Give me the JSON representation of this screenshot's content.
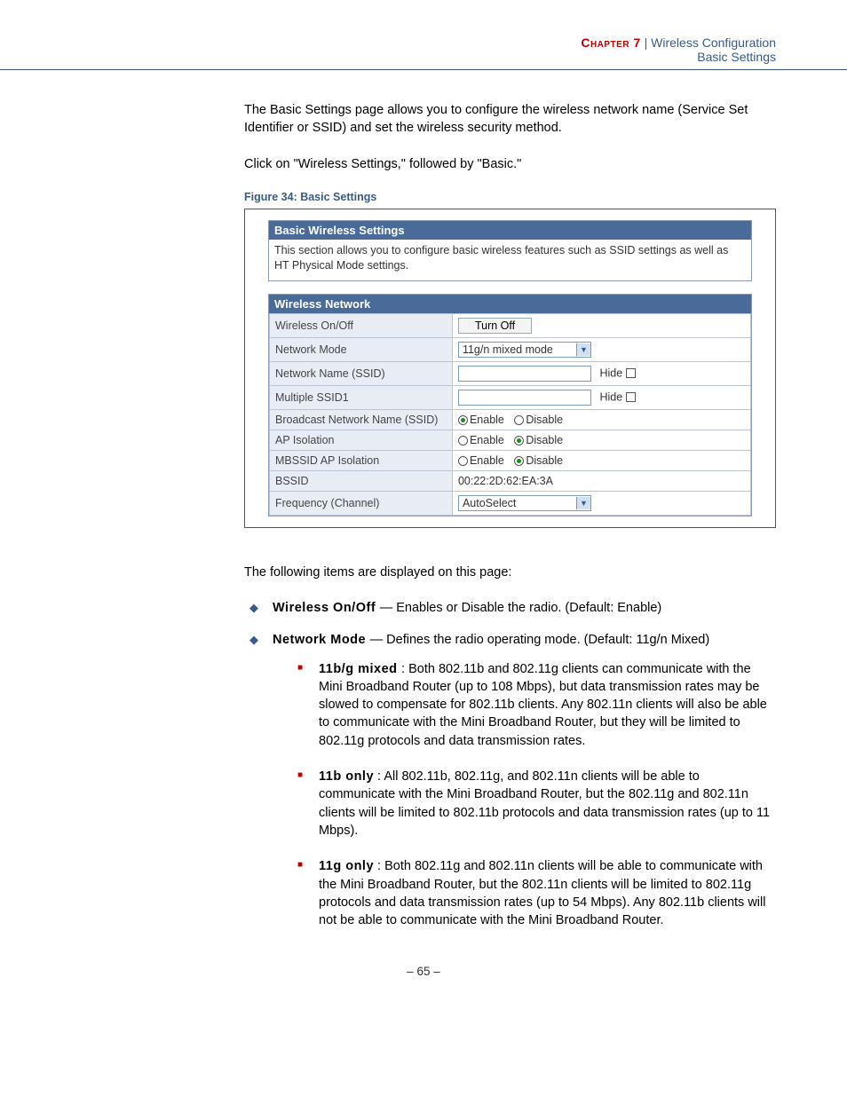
{
  "header": {
    "chapter": "Chapter  7",
    "separator": "|",
    "section": "Wireless Configuration",
    "subsection": "Basic Settings"
  },
  "intro": {
    "p1": "The Basic Settings page allows you to configure the wireless network name (Service Set Identifier or SSID) and set the wireless security method.",
    "p2": "Click on \"Wireless Settings,\" followed by \"Basic.\""
  },
  "figure": {
    "caption": "Figure 34:  Basic Settings",
    "panel_title": "Basic Wireless Settings",
    "panel_desc": "This section allows you to configure basic wireless features such as SSID settings as well as HT Physical Mode settings.",
    "section_title": "Wireless Network",
    "rows": {
      "wireless_onoff": {
        "label": "Wireless On/Off",
        "button": "Turn Off"
      },
      "network_mode": {
        "label": "Network Mode",
        "value": "11g/n mixed mode"
      },
      "ssid": {
        "label": "Network Name (SSID)",
        "hide": "Hide"
      },
      "mssid1": {
        "label": "Multiple SSID1",
        "hide": "Hide"
      },
      "broadcast": {
        "label": "Broadcast Network Name (SSID)",
        "enable": "Enable",
        "disable": "Disable",
        "selected": "enable"
      },
      "ap_iso": {
        "label": "AP Isolation",
        "enable": "Enable",
        "disable": "Disable",
        "selected": "disable"
      },
      "mbssid_iso": {
        "label": "MBSSID AP Isolation",
        "enable": "Enable",
        "disable": "Disable",
        "selected": "disable"
      },
      "bssid": {
        "label": "BSSID",
        "value": "00:22:2D:62:EA:3A"
      },
      "freq": {
        "label": "Frequency (Channel)",
        "value": "AutoSelect"
      }
    }
  },
  "body": {
    "lead": "The following items are displayed on this page:",
    "items": [
      {
        "term": "Wireless On/Off ",
        "desc": " — Enables or Disable the radio. (Default: Enable)"
      },
      {
        "term": "Network Mode ",
        "desc": " — Defines the radio operating mode. (Default: 11g/n Mixed)"
      }
    ],
    "subitems": [
      {
        "term": "11b/g mixed ",
        "desc": " : Both 802.11b and 802.11g clients can communicate with the Mini Broadband Router (up to 108 Mbps), but data transmission rates may be slowed to compensate for 802.11b clients. Any 802.11n clients will also be able to communicate with the Mini Broadband Router, but they will be limited to 802.11g protocols and data transmission rates."
      },
      {
        "term": "11b only",
        "desc": " : All 802.11b, 802.11g, and 802.11n clients will be able to communicate with the Mini Broadband Router, but the 802.11g and 802.11n clients will be limited to 802.11b protocols and data transmission rates (up to 11 Mbps)."
      },
      {
        "term": "11g only",
        "desc": " : Both 802.11g and 802.11n clients will be able to communicate with the Mini Broadband Router, but the 802.11n clients will be limited to 802.11g protocols and data transmission rates (up to 54 Mbps). Any 802.11b clients will not be able to communicate with the Mini Broadband Router."
      }
    ]
  },
  "footer": {
    "page": "– 65 –"
  }
}
